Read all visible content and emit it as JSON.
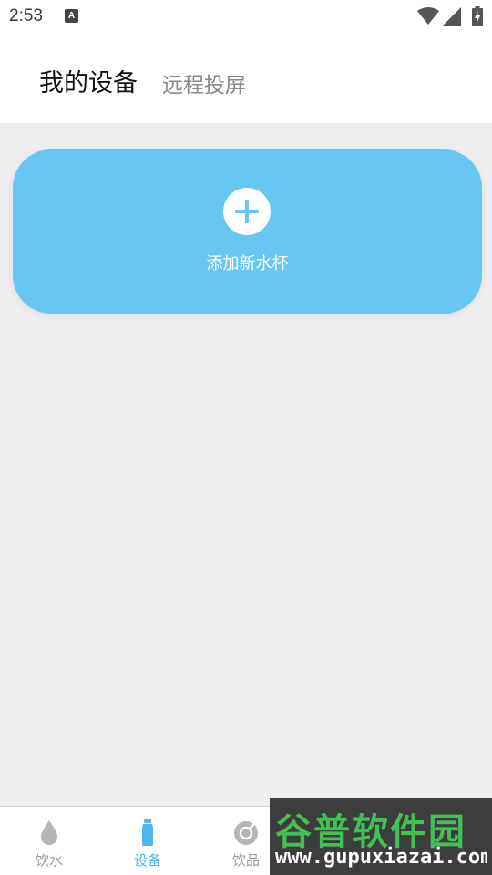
{
  "status_bar": {
    "time": "2:53",
    "notification_icon_letter": "A",
    "icons": [
      "wifi-icon",
      "signal-icon",
      "battery-charging-icon"
    ]
  },
  "header": {
    "tabs": [
      {
        "label": "我的设备",
        "active": true
      },
      {
        "label": "远程投屏",
        "active": false
      }
    ]
  },
  "add_card": {
    "label": "添加新水杯",
    "icon": "plus-icon",
    "color": "#68c6f2"
  },
  "bottom_nav": {
    "active_color": "#4fb8ec",
    "inactive_color": "#9a9a9a",
    "items": [
      {
        "label": "饮水",
        "icon": "water-drop-icon",
        "active": false
      },
      {
        "label": "设备",
        "icon": "bottle-icon",
        "active": true
      },
      {
        "label": "饮品",
        "icon": "drink-icon",
        "active": false
      }
    ]
  },
  "watermark": {
    "title": "谷普软件园",
    "url": "www.gupuxiazai.com"
  }
}
